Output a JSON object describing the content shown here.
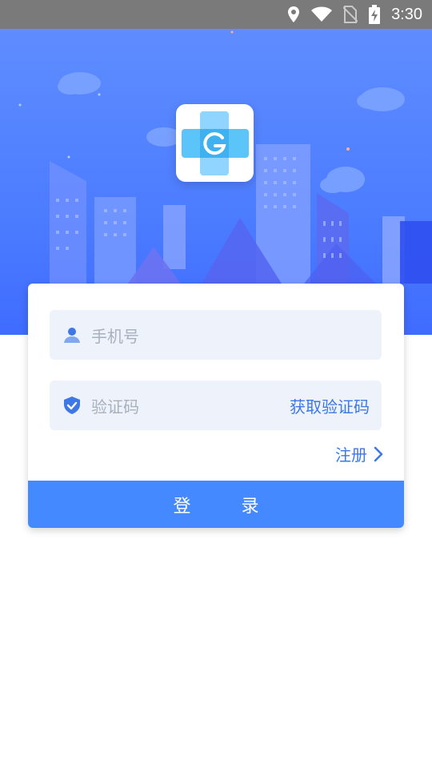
{
  "status_bar": {
    "time": "3:30",
    "icons": [
      "location-icon",
      "wifi-icon",
      "no-sim-icon",
      "battery-charging-icon"
    ]
  },
  "login": {
    "phone_placeholder": "手机号",
    "code_placeholder": "验证码",
    "get_code_label": "获取验证码",
    "register_label": "注册",
    "login_label": "登 录"
  },
  "colors": {
    "accent": "#4489ff",
    "link": "#3d78e6",
    "header": "#4c7dff"
  }
}
